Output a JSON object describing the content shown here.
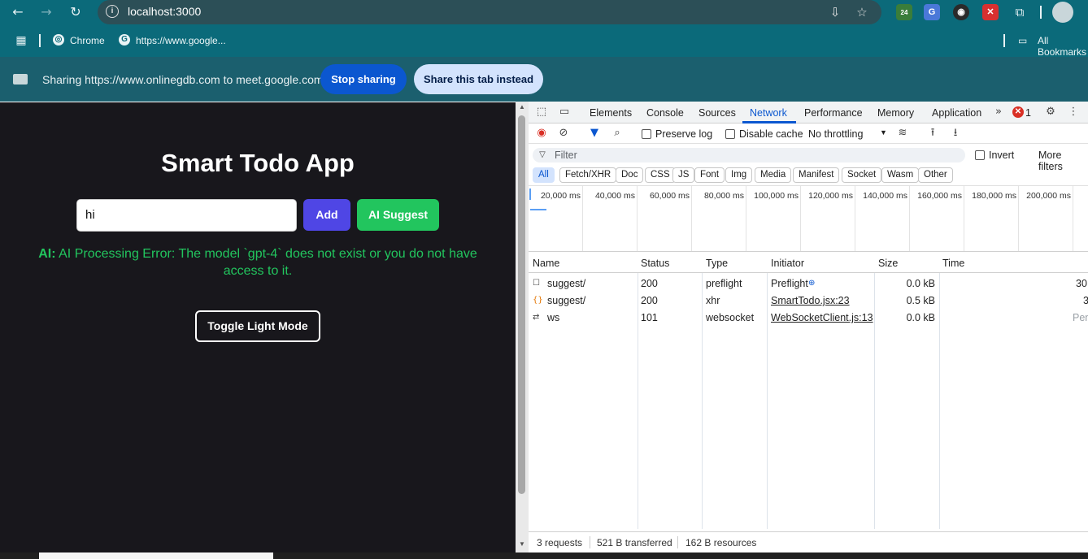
{
  "browser": {
    "url": "localhost:3000",
    "bookmarks": [
      {
        "label": "Chrome"
      },
      {
        "label": "https://www.google..."
      },
      {
        "label": "All Bookmarks"
      }
    ],
    "extension_badge": "24"
  },
  "sharing": {
    "message": "Sharing https://www.onlinegdb.com to meet.google.com",
    "stop_label": "Stop sharing",
    "share_tab_label": "Share this tab instead"
  },
  "app": {
    "title": "Smart Todo App",
    "input_value": "hi",
    "add_label": "Add",
    "suggest_label": "AI Suggest",
    "ai_prefix": "AI:",
    "ai_message": "AI Processing Error: The model `gpt-4` does not exist or you do not have access to it.",
    "toggle_label": "Toggle Light Mode"
  },
  "devtools": {
    "tabs": [
      "Elements",
      "Console",
      "Sources",
      "Network",
      "Performance",
      "Memory",
      "Application"
    ],
    "active_tab": "Network",
    "error_count": "1",
    "preserve_log": "Preserve log",
    "disable_cache": "Disable cache",
    "throttling": "No throttling",
    "filter_placeholder": "Filter",
    "invert": "Invert",
    "more_filters": "More filters",
    "filter_chips": [
      "All",
      "Fetch/XHR",
      "Doc",
      "CSS",
      "JS",
      "Font",
      "Img",
      "Media",
      "Manifest",
      "Socket",
      "Wasm",
      "Other"
    ],
    "timeline_labels": [
      "20,000 ms",
      "40,000 ms",
      "60,000 ms",
      "80,000 ms",
      "100,000 ms",
      "120,000 ms",
      "140,000 ms",
      "160,000 ms",
      "180,000 ms",
      "200,000 ms"
    ],
    "columns": [
      "Name",
      "Status",
      "Type",
      "Initiator",
      "Size",
      "Time"
    ],
    "rows": [
      {
        "icon": "document-icon",
        "name": "suggest/",
        "status": "200",
        "type": "preflight",
        "initiator": "Preflight",
        "size": "0.0 kB",
        "time": "30"
      },
      {
        "icon": "xhr-icon",
        "name": "suggest/",
        "status": "200",
        "type": "xhr",
        "initiator": "SmartTodo.jsx:23",
        "size": "0.5 kB",
        "time": "3"
      },
      {
        "icon": "websocket-icon",
        "name": "ws",
        "status": "101",
        "type": "websocket",
        "initiator": "WebSocketClient.js:13",
        "size": "0.0 kB",
        "time": "Pen"
      }
    ],
    "status": {
      "requests": "3 requests",
      "transferred": "521 B transferred",
      "resources": "162 B resources"
    }
  },
  "colors": {
    "browser_chrome": "#0b6a7a",
    "app_bg": "#18171c",
    "add_button": "#4f46e5",
    "ai_green": "#22c55e",
    "devtools_accent": "#0b57d0"
  }
}
